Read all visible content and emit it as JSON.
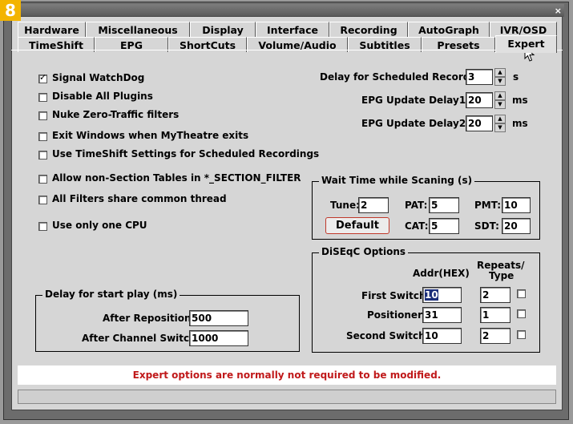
{
  "badge": "8",
  "tabs_row1": [
    "Hardware",
    "Miscellaneous",
    "Display",
    "Interface",
    "Recording",
    "AutoGraph",
    "IVR/OSD"
  ],
  "tabs_row2": [
    "TimeShift",
    "EPG",
    "ShortCuts",
    "Volume/Audio",
    "Subtitles",
    "Presets",
    "Expert"
  ],
  "active_tab": "Expert",
  "options": [
    {
      "label": "Signal WatchDog",
      "checked": true
    },
    {
      "label": "Disable All Plugins",
      "checked": false
    },
    {
      "label": "Nuke Zero-Traffic filters",
      "checked": false
    },
    {
      "label": "Exit Windows when MyTheatre exits",
      "checked": false
    },
    {
      "label": "Use TimeShift Settings for Scheduled Recordings",
      "checked": false
    },
    {
      "label": "Allow non-Section Tables in *_SECTION_FILTER",
      "checked": false
    },
    {
      "label": "All Filters share common thread",
      "checked": false
    },
    {
      "label": "Use only one CPU",
      "checked": false
    }
  ],
  "delays": {
    "scheduled": {
      "label": "Delay for Scheduled Record",
      "value": "3",
      "unit": "s"
    },
    "epg1": {
      "label": "EPG Update Delay1",
      "value": "20",
      "unit": "ms"
    },
    "epg2": {
      "label": "EPG Update Delay2",
      "value": "20",
      "unit": "ms"
    }
  },
  "wait_group": {
    "title": "Wait Time while Scaning (s)",
    "tune": {
      "label": "Tune:",
      "value": "2"
    },
    "pat": {
      "label": "PAT:",
      "value": "5"
    },
    "pmt": {
      "label": "PMT:",
      "value": "10"
    },
    "cat": {
      "label": "CAT:",
      "value": "5"
    },
    "sdt": {
      "label": "SDT:",
      "value": "20"
    },
    "default_label": "Default"
  },
  "diseqc": {
    "title": "DiSEqC Options",
    "col_addr": "Addr(HEX)",
    "col_repeats_1": "Repeats/",
    "col_repeats_2": "Type",
    "rows": [
      {
        "label": "First Switch",
        "addr": "10",
        "repeats": "2",
        "checked": false
      },
      {
        "label": "Positioner",
        "addr": "31",
        "repeats": "1",
        "checked": false
      },
      {
        "label": "Second Switch",
        "addr": "10",
        "repeats": "2",
        "checked": false
      }
    ]
  },
  "start_play": {
    "title": "Delay for start play  (ms)",
    "after_reposition": {
      "label": "After Reposition:",
      "value": "500"
    },
    "after_switch": {
      "label": "After Channel Switch:",
      "value": "1000"
    }
  },
  "notice": "Expert options are normally not required to be modified.",
  "close_glyph": "×",
  "spin_up": "▲",
  "spin_down": "▼"
}
